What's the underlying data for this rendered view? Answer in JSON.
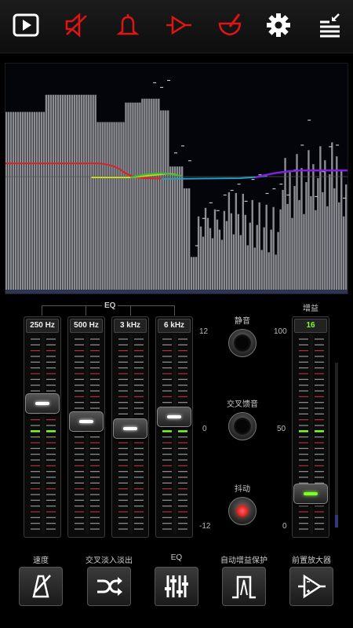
{
  "toolbar": {
    "icons": [
      "play-icon",
      "speaker-icon",
      "bell-icon",
      "diode-icon",
      "mortar-icon",
      "gear-icon",
      "menu-icon"
    ],
    "active_color": "#ffffff",
    "inactive_color": "#e01414"
  },
  "eq": {
    "label": "EQ",
    "bands": [
      {
        "label": "250 Hz",
        "value_db": 3
      },
      {
        "label": "500 Hz",
        "value_db": 1
      },
      {
        "label": "3 kHz",
        "value_db": 0
      },
      {
        "label": "6 kHz",
        "value_db": 1.5
      }
    ],
    "scale": {
      "top": "12",
      "mid": "0",
      "bottom": "-12"
    }
  },
  "controls": {
    "mute_label": "静音",
    "crossfeed_label": "交叉馈音",
    "dither_label": "抖动"
  },
  "gain": {
    "label": "增益",
    "value": "16",
    "scale": {
      "top": "100",
      "mid": "50",
      "bottom": "0"
    }
  },
  "bottom": {
    "speed_label": "速度",
    "crossfade_label": "交叉淡入淡出",
    "eq_label": "EQ",
    "agc_label": "自动增益保护",
    "preamp_label": "前置放大器"
  },
  "colors": {
    "accent_green": "#7dff2a",
    "led_red": "#ff2020"
  }
}
